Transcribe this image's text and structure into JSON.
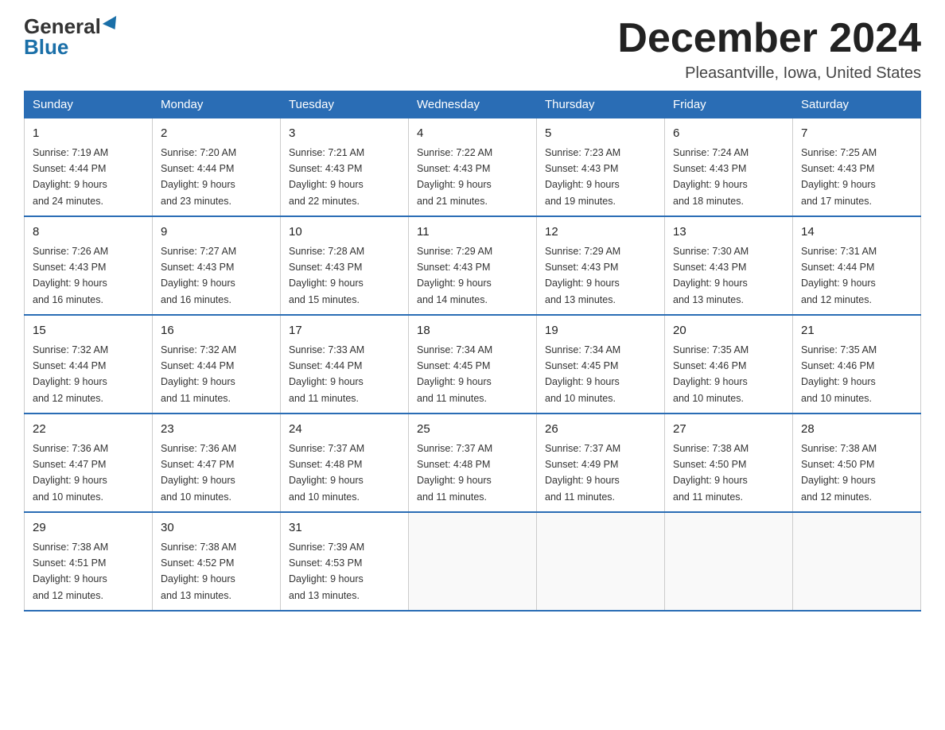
{
  "logo": {
    "general": "General",
    "blue": "Blue"
  },
  "title": {
    "month_year": "December 2024",
    "location": "Pleasantville, Iowa, United States"
  },
  "weekdays": [
    "Sunday",
    "Monday",
    "Tuesday",
    "Wednesday",
    "Thursday",
    "Friday",
    "Saturday"
  ],
  "weeks": [
    [
      {
        "day": "1",
        "sunrise": "7:19 AM",
        "sunset": "4:44 PM",
        "daylight": "9 hours and 24 minutes."
      },
      {
        "day": "2",
        "sunrise": "7:20 AM",
        "sunset": "4:44 PM",
        "daylight": "9 hours and 23 minutes."
      },
      {
        "day": "3",
        "sunrise": "7:21 AM",
        "sunset": "4:43 PM",
        "daylight": "9 hours and 22 minutes."
      },
      {
        "day": "4",
        "sunrise": "7:22 AM",
        "sunset": "4:43 PM",
        "daylight": "9 hours and 21 minutes."
      },
      {
        "day": "5",
        "sunrise": "7:23 AM",
        "sunset": "4:43 PM",
        "daylight": "9 hours and 19 minutes."
      },
      {
        "day": "6",
        "sunrise": "7:24 AM",
        "sunset": "4:43 PM",
        "daylight": "9 hours and 18 minutes."
      },
      {
        "day": "7",
        "sunrise": "7:25 AM",
        "sunset": "4:43 PM",
        "daylight": "9 hours and 17 minutes."
      }
    ],
    [
      {
        "day": "8",
        "sunrise": "7:26 AM",
        "sunset": "4:43 PM",
        "daylight": "9 hours and 16 minutes."
      },
      {
        "day": "9",
        "sunrise": "7:27 AM",
        "sunset": "4:43 PM",
        "daylight": "9 hours and 16 minutes."
      },
      {
        "day": "10",
        "sunrise": "7:28 AM",
        "sunset": "4:43 PM",
        "daylight": "9 hours and 15 minutes."
      },
      {
        "day": "11",
        "sunrise": "7:29 AM",
        "sunset": "4:43 PM",
        "daylight": "9 hours and 14 minutes."
      },
      {
        "day": "12",
        "sunrise": "7:29 AM",
        "sunset": "4:43 PM",
        "daylight": "9 hours and 13 minutes."
      },
      {
        "day": "13",
        "sunrise": "7:30 AM",
        "sunset": "4:43 PM",
        "daylight": "9 hours and 13 minutes."
      },
      {
        "day": "14",
        "sunrise": "7:31 AM",
        "sunset": "4:44 PM",
        "daylight": "9 hours and 12 minutes."
      }
    ],
    [
      {
        "day": "15",
        "sunrise": "7:32 AM",
        "sunset": "4:44 PM",
        "daylight": "9 hours and 12 minutes."
      },
      {
        "day": "16",
        "sunrise": "7:32 AM",
        "sunset": "4:44 PM",
        "daylight": "9 hours and 11 minutes."
      },
      {
        "day": "17",
        "sunrise": "7:33 AM",
        "sunset": "4:44 PM",
        "daylight": "9 hours and 11 minutes."
      },
      {
        "day": "18",
        "sunrise": "7:34 AM",
        "sunset": "4:45 PM",
        "daylight": "9 hours and 11 minutes."
      },
      {
        "day": "19",
        "sunrise": "7:34 AM",
        "sunset": "4:45 PM",
        "daylight": "9 hours and 10 minutes."
      },
      {
        "day": "20",
        "sunrise": "7:35 AM",
        "sunset": "4:46 PM",
        "daylight": "9 hours and 10 minutes."
      },
      {
        "day": "21",
        "sunrise": "7:35 AM",
        "sunset": "4:46 PM",
        "daylight": "9 hours and 10 minutes."
      }
    ],
    [
      {
        "day": "22",
        "sunrise": "7:36 AM",
        "sunset": "4:47 PM",
        "daylight": "9 hours and 10 minutes."
      },
      {
        "day": "23",
        "sunrise": "7:36 AM",
        "sunset": "4:47 PM",
        "daylight": "9 hours and 10 minutes."
      },
      {
        "day": "24",
        "sunrise": "7:37 AM",
        "sunset": "4:48 PM",
        "daylight": "9 hours and 10 minutes."
      },
      {
        "day": "25",
        "sunrise": "7:37 AM",
        "sunset": "4:48 PM",
        "daylight": "9 hours and 11 minutes."
      },
      {
        "day": "26",
        "sunrise": "7:37 AM",
        "sunset": "4:49 PM",
        "daylight": "9 hours and 11 minutes."
      },
      {
        "day": "27",
        "sunrise": "7:38 AM",
        "sunset": "4:50 PM",
        "daylight": "9 hours and 11 minutes."
      },
      {
        "day": "28",
        "sunrise": "7:38 AM",
        "sunset": "4:50 PM",
        "daylight": "9 hours and 12 minutes."
      }
    ],
    [
      {
        "day": "29",
        "sunrise": "7:38 AM",
        "sunset": "4:51 PM",
        "daylight": "9 hours and 12 minutes."
      },
      {
        "day": "30",
        "sunrise": "7:38 AM",
        "sunset": "4:52 PM",
        "daylight": "9 hours and 13 minutes."
      },
      {
        "day": "31",
        "sunrise": "7:39 AM",
        "sunset": "4:53 PM",
        "daylight": "9 hours and 13 minutes."
      },
      null,
      null,
      null,
      null
    ]
  ],
  "labels": {
    "sunrise": "Sunrise:",
    "sunset": "Sunset:",
    "daylight": "Daylight:"
  }
}
